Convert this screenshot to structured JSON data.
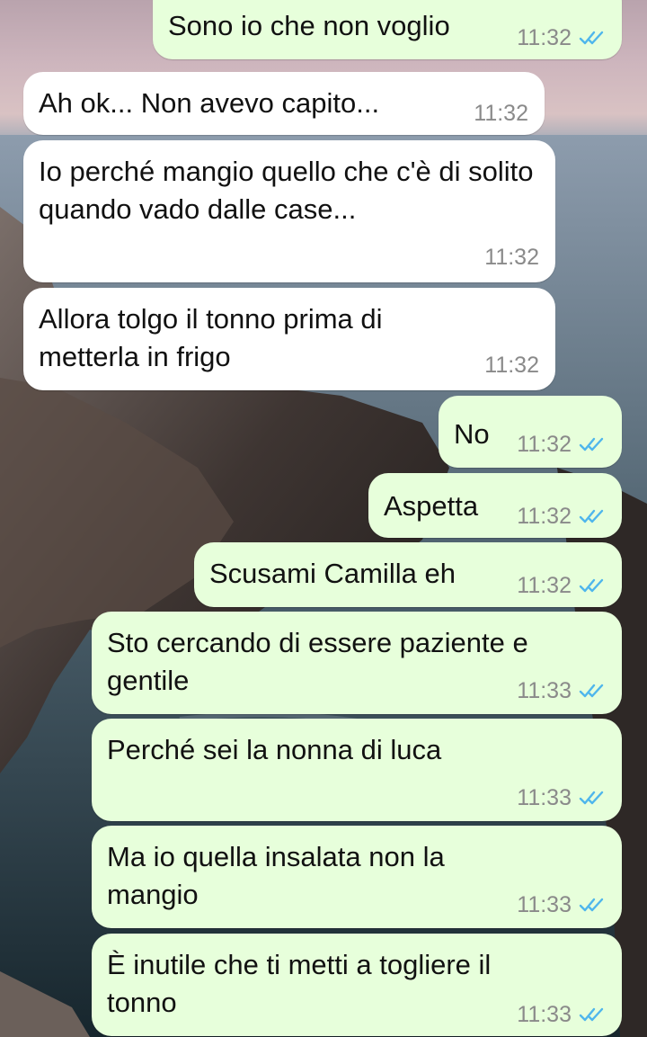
{
  "theme": {
    "incoming_bubble": "#ffffff",
    "outgoing_bubble": "#e7ffdb",
    "timestamp_color": "#8a8a8a",
    "read_tick_color": "#4fb6ec"
  },
  "messages": [
    {
      "direction": "out",
      "text": "Sono io che non voglio",
      "time": "11:32",
      "status": "read"
    },
    {
      "direction": "in",
      "text": "Ah ok... Non avevo capito...",
      "time": "11:32"
    },
    {
      "direction": "in",
      "text": "Io perché mangio quello che c'è di solito quando vado dalle case...",
      "time": "11:32"
    },
    {
      "direction": "in",
      "text": "Allora tolgo il tonno prima di metterla in frigo",
      "time": "11:32"
    },
    {
      "direction": "out",
      "text": "No",
      "time": "11:32",
      "status": "read"
    },
    {
      "direction": "out",
      "text": "Aspetta",
      "time": "11:32",
      "status": "read"
    },
    {
      "direction": "out",
      "text": "Scusami Camilla eh",
      "time": "11:32",
      "status": "read"
    },
    {
      "direction": "out",
      "text": "Sto cercando di essere paziente e gentile",
      "time": "11:33",
      "status": "read"
    },
    {
      "direction": "out",
      "text": "Perché sei la nonna di luca",
      "time": "11:33",
      "status": "read"
    },
    {
      "direction": "out",
      "text": "Ma io quella insalata non la mangio",
      "time": "11:33",
      "status": "read"
    },
    {
      "direction": "out",
      "text": "È inutile che ti metti a togliere il tonno",
      "time": "11:33",
      "status": "read"
    }
  ]
}
